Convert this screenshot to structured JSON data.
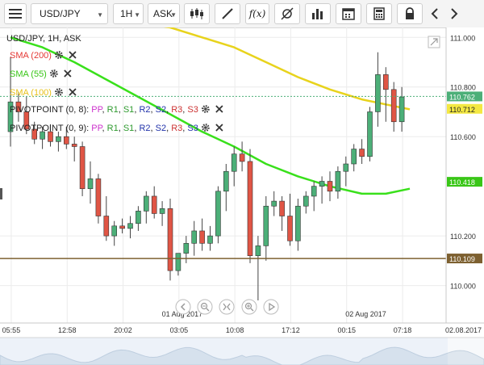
{
  "toolbar": {
    "symbol": "USD/JPY",
    "timeframe": "1H",
    "price_type": "ASK",
    "icons": [
      "menu-icon",
      "candlestick-icon",
      "draw-line-icon",
      "function-icon",
      "crosshair-icon",
      "bar-chart-icon",
      "calendar-icon",
      "calculator-icon",
      "lock-icon",
      "chevron-left-icon",
      "chevron-right-icon"
    ],
    "function_label": "f(x)"
  },
  "chart_data": {
    "type": "candlestick",
    "title": "USD/JPY, 1H, ASK",
    "y_range": [
      109.94,
      111.04
    ],
    "y_ticks": [
      {
        "label": "111.000",
        "value": 111.0
      },
      {
        "label": "110.800",
        "value": 110.8
      },
      {
        "label": "110.600",
        "value": 110.6
      },
      {
        "label": "110.200",
        "value": 110.2
      },
      {
        "label": "110.000",
        "value": 110.0
      }
    ],
    "x_ticks": [
      {
        "label": "05:55",
        "index": 0.5
      },
      {
        "label": "12:58",
        "index": 7.5
      },
      {
        "label": "20:02",
        "index": 14.5
      },
      {
        "label": "03:05",
        "index": 21.5
      },
      {
        "label": "10:08",
        "index": 28.5
      },
      {
        "label": "17:12",
        "index": 35.5
      },
      {
        "label": "00:15",
        "index": 42.5
      },
      {
        "label": "07:18",
        "index": 49.5
      }
    ],
    "corner_date": "02.08.2017",
    "date_labels": [
      {
        "label": "01 Aug 2017",
        "index": 21.5
      },
      {
        "label": "02 Aug 2017",
        "index": 44.5
      }
    ],
    "candles": [
      {
        "o": 110.62,
        "h": 110.92,
        "l": 110.56,
        "c": 110.74
      },
      {
        "o": 110.74,
        "h": 110.78,
        "l": 110.66,
        "c": 110.7
      },
      {
        "o": 110.7,
        "h": 110.76,
        "l": 110.61,
        "c": 110.63
      },
      {
        "o": 110.63,
        "h": 110.66,
        "l": 110.57,
        "c": 110.59
      },
      {
        "o": 110.59,
        "h": 110.64,
        "l": 110.55,
        "c": 110.62
      },
      {
        "o": 110.62,
        "h": 110.65,
        "l": 110.56,
        "c": 110.58
      },
      {
        "o": 110.58,
        "h": 110.62,
        "l": 110.54,
        "c": 110.6
      },
      {
        "o": 110.6,
        "h": 110.64,
        "l": 110.55,
        "c": 110.57
      },
      {
        "o": 110.57,
        "h": 110.6,
        "l": 110.5,
        "c": 110.56
      },
      {
        "o": 110.56,
        "h": 110.58,
        "l": 110.36,
        "c": 110.39
      },
      {
        "o": 110.39,
        "h": 110.5,
        "l": 110.33,
        "c": 110.43
      },
      {
        "o": 110.43,
        "h": 110.45,
        "l": 110.25,
        "c": 110.28
      },
      {
        "o": 110.28,
        "h": 110.36,
        "l": 110.18,
        "c": 110.2
      },
      {
        "o": 110.2,
        "h": 110.26,
        "l": 110.16,
        "c": 110.24
      },
      {
        "o": 110.24,
        "h": 110.27,
        "l": 110.21,
        "c": 110.23
      },
      {
        "o": 110.23,
        "h": 110.28,
        "l": 110.19,
        "c": 110.25
      },
      {
        "o": 110.25,
        "h": 110.32,
        "l": 110.22,
        "c": 110.3
      },
      {
        "o": 110.3,
        "h": 110.38,
        "l": 110.25,
        "c": 110.36
      },
      {
        "o": 110.36,
        "h": 110.4,
        "l": 110.27,
        "c": 110.29
      },
      {
        "o": 110.29,
        "h": 110.34,
        "l": 110.24,
        "c": 110.31
      },
      {
        "o": 110.31,
        "h": 110.35,
        "l": 110.02,
        "c": 110.06
      },
      {
        "o": 110.06,
        "h": 110.1,
        "l": 110.04,
        "c": 110.13
      },
      {
        "o": 110.13,
        "h": 110.2,
        "l": 110.09,
        "c": 110.17
      },
      {
        "o": 110.17,
        "h": 110.26,
        "l": 110.12,
        "c": 110.22
      },
      {
        "o": 110.22,
        "h": 110.27,
        "l": 110.14,
        "c": 110.17
      },
      {
        "o": 110.17,
        "h": 110.24,
        "l": 110.14,
        "c": 110.2
      },
      {
        "o": 110.2,
        "h": 110.4,
        "l": 110.17,
        "c": 110.38
      },
      {
        "o": 110.38,
        "h": 110.49,
        "l": 110.3,
        "c": 110.46
      },
      {
        "o": 110.46,
        "h": 110.56,
        "l": 110.4,
        "c": 110.53
      },
      {
        "o": 110.53,
        "h": 110.58,
        "l": 110.46,
        "c": 110.5
      },
      {
        "o": 110.5,
        "h": 110.55,
        "l": 110.09,
        "c": 110.12
      },
      {
        "o": 110.12,
        "h": 110.2,
        "l": 109.94,
        "c": 110.16
      },
      {
        "o": 110.16,
        "h": 110.36,
        "l": 110.1,
        "c": 110.32
      },
      {
        "o": 110.32,
        "h": 110.38,
        "l": 110.28,
        "c": 110.34
      },
      {
        "o": 110.34,
        "h": 110.36,
        "l": 110.22,
        "c": 110.28
      },
      {
        "o": 110.28,
        "h": 110.37,
        "l": 110.16,
        "c": 110.18
      },
      {
        "o": 110.18,
        "h": 110.35,
        "l": 110.14,
        "c": 110.32
      },
      {
        "o": 110.32,
        "h": 110.38,
        "l": 110.29,
        "c": 110.36
      },
      {
        "o": 110.36,
        "h": 110.42,
        "l": 110.3,
        "c": 110.4
      },
      {
        "o": 110.4,
        "h": 110.44,
        "l": 110.33,
        "c": 110.42
      },
      {
        "o": 110.42,
        "h": 110.46,
        "l": 110.34,
        "c": 110.38
      },
      {
        "o": 110.38,
        "h": 110.48,
        "l": 110.35,
        "c": 110.46
      },
      {
        "o": 110.46,
        "h": 110.52,
        "l": 110.4,
        "c": 110.49
      },
      {
        "o": 110.49,
        "h": 110.57,
        "l": 110.46,
        "c": 110.55
      },
      {
        "o": 110.55,
        "h": 110.59,
        "l": 110.49,
        "c": 110.52
      },
      {
        "o": 110.52,
        "h": 110.72,
        "l": 110.5,
        "c": 110.7
      },
      {
        "o": 110.7,
        "h": 110.94,
        "l": 110.64,
        "c": 110.85
      },
      {
        "o": 110.85,
        "h": 110.88,
        "l": 110.66,
        "c": 110.79
      },
      {
        "o": 110.79,
        "h": 110.82,
        "l": 110.62,
        "c": 110.66
      },
      {
        "o": 110.66,
        "h": 110.8,
        "l": 110.62,
        "c": 110.76
      }
    ],
    "series": [
      {
        "name": "SMA (200)",
        "color": "#e53935",
        "values": []
      },
      {
        "name": "SMA (55)",
        "color": "#39e01b",
        "x": [
          0,
          4,
          8,
          12,
          16,
          20,
          24,
          28,
          32,
          36,
          40,
          44,
          47,
          50
        ],
        "values": [
          111.0,
          110.96,
          110.9,
          110.83,
          110.76,
          110.69,
          110.62,
          110.56,
          110.49,
          110.44,
          110.4,
          110.37,
          110.37,
          110.39
        ]
      },
      {
        "name": "SMA (100)",
        "color": "#e8d31c",
        "x": [
          0,
          4,
          8,
          12,
          16,
          20,
          24,
          28,
          32,
          36,
          40,
          44,
          47,
          50
        ],
        "values": [
          111.1,
          111.1,
          111.09,
          111.08,
          111.06,
          111.04,
          111.0,
          110.96,
          110.9,
          110.84,
          110.79,
          110.75,
          110.73,
          110.71
        ]
      }
    ],
    "price_labels": [
      {
        "label": "110.762",
        "value": 110.762,
        "bg": "#4caf78",
        "fg": "#ffffff"
      },
      {
        "label": "110.712",
        "value": 110.712,
        "bg": "#f4e842",
        "fg": "#222222"
      },
      {
        "label": "110.418",
        "value": 110.418,
        "bg": "#39c617",
        "fg": "#ffffff"
      },
      {
        "label": "110.109",
        "value": 110.109,
        "bg": "#7d6030",
        "fg": "#ffffff"
      }
    ],
    "hline": {
      "value": 110.109,
      "color": "#7d6030"
    },
    "ask_line": {
      "value": 110.762,
      "color": "#4caf78"
    },
    "indicators": [
      {
        "label": "SMA (200)",
        "color": "#e53935"
      },
      {
        "label": "SMA (55)",
        "color": "#39c617"
      },
      {
        "label": "SMA (100)",
        "color": "#e8c21c"
      }
    ],
    "pivots": [
      {
        "head": "PIVOTPOINT (0, 8):",
        "color": "#e53935"
      },
      {
        "head": "PIVOTPOINT (0, 9):",
        "color": "#e53935"
      }
    ],
    "pivot_parts": [
      {
        "t": "PP",
        "c": "#cc33cc"
      },
      {
        "t": "R1",
        "c": "#2e9a2e"
      },
      {
        "t": "S1",
        "c": "#2e9a2e"
      },
      {
        "t": "R2",
        "c": "#2233aa"
      },
      {
        "t": "S2",
        "c": "#2233aa"
      },
      {
        "t": "R3",
        "c": "#cc3333"
      },
      {
        "t": "S3",
        "c": "#cc3333"
      }
    ],
    "pivot_parts_2": [
      {
        "t": "PP",
        "c": "#cc33cc"
      },
      {
        "t": "R1",
        "c": "#2e9a2e"
      },
      {
        "t": "S1",
        "c": "#2e9a2e"
      },
      {
        "t": "R2",
        "c": "#2233aa"
      },
      {
        "t": "S2",
        "c": "#2233aa"
      },
      {
        "t": "R3",
        "c": "#cc3333"
      },
      {
        "t": "S3",
        "c": "#2233aa"
      }
    ],
    "colors": {
      "up": "#4caf78",
      "down": "#e05545",
      "grid": "#ececec",
      "axis": "#c8c8c8",
      "text": "#333333"
    }
  }
}
